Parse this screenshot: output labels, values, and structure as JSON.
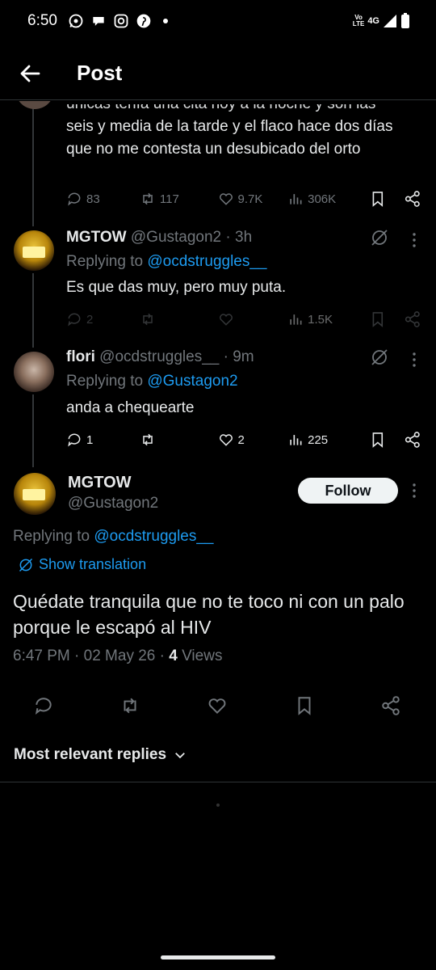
{
  "status_bar": {
    "time": "6:50",
    "volte": "Vo\nLTE",
    "network": "4G"
  },
  "header": {
    "title": "Post"
  },
  "prev_tweet": {
    "text_partial": "únicas tenía una cita hoy a la noche y son las",
    "text": "seis y media de la tarde y el flaco hace dos días que no me contesta un desubicado del orto",
    "replies": "83",
    "reposts": "117",
    "likes": "9.7K",
    "views": "306K"
  },
  "reply1": {
    "name": "MGTOW",
    "handle": "@Gustagon2 · 3h",
    "replying_prefix": "Replying to ",
    "replying_to": "@ocdstruggles__",
    "text": "Es que das muy, pero muy puta.",
    "replies": "2",
    "views": "1.5K"
  },
  "reply2": {
    "name": "flori",
    "handle": "@ocdstruggles__ · 9m",
    "replying_prefix": "Replying to ",
    "replying_to": "@Gustagon2",
    "text": "anda a chequearte",
    "replies": "1",
    "likes": "2",
    "views": "225"
  },
  "main_tweet": {
    "name": "MGTOW",
    "handle": "@Gustagon2",
    "follow_label": "Follow",
    "replying_prefix": "Replying to ",
    "replying_to": "@ocdstruggles__",
    "show_translation": "Show translation",
    "text": "Quédate tranquila que no te toco ni con un palo porque le escapó al HIV",
    "timestamp": "6:47 PM · 02 May 26 · ",
    "views_count": "4",
    "views_label": " Views"
  },
  "replies_sort": {
    "label": "Most relevant replies"
  },
  "colors": {
    "background": "#000000",
    "link": "#1d9bf0",
    "muted": "#71767b",
    "text": "#e7e9ea"
  }
}
